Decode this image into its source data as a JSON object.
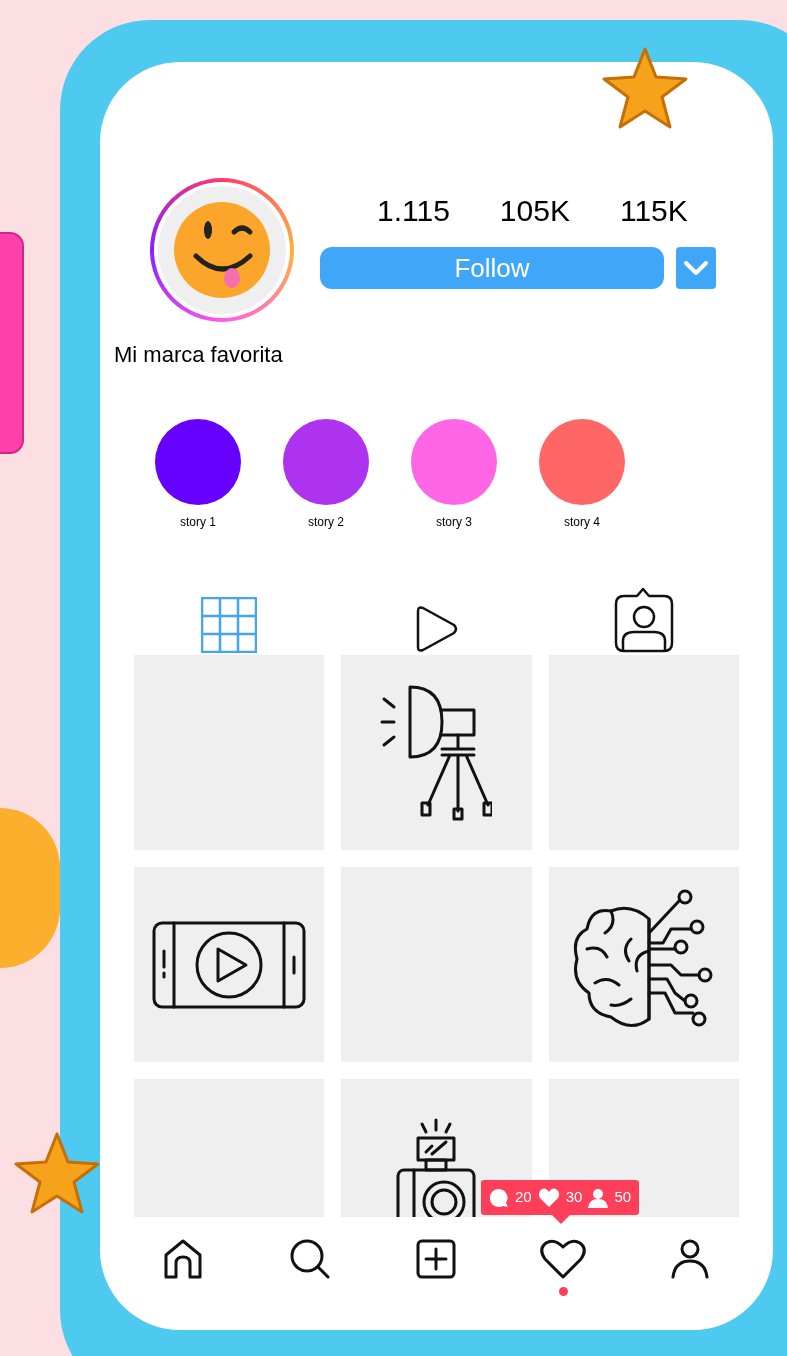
{
  "profile": {
    "name": "Mi marca favorita",
    "stats": [
      "1.115",
      "105K",
      "115K"
    ],
    "follow_button": "Follow"
  },
  "stories": [
    {
      "label": "story 1",
      "color": "#6600ff"
    },
    {
      "label": "story 2",
      "color": "#ad33ee"
    },
    {
      "label": "story 3",
      "color": "#ff66e6"
    },
    {
      "label": "story 4",
      "color": "#ff6666"
    }
  ],
  "tabs": [
    {
      "kind": "grid",
      "selected": true
    },
    {
      "kind": "reels",
      "selected": false
    },
    {
      "kind": "tagged",
      "selected": false
    }
  ],
  "posts": [
    {
      "kind": "blank"
    },
    {
      "kind": "studio-light"
    },
    {
      "kind": "blank"
    },
    {
      "kind": "video"
    },
    {
      "kind": "blank"
    },
    {
      "kind": "brain"
    },
    {
      "kind": "blank"
    },
    {
      "kind": "camera"
    },
    {
      "kind": "blank"
    }
  ],
  "activity_badge": {
    "comments": "20",
    "likes": "30",
    "followers": "50"
  },
  "nav": [
    {
      "kind": "home",
      "selected": false
    },
    {
      "kind": "search",
      "selected": false
    },
    {
      "kind": "add",
      "selected": false
    },
    {
      "kind": "heart",
      "selected": true
    },
    {
      "kind": "profile",
      "selected": false
    }
  ]
}
